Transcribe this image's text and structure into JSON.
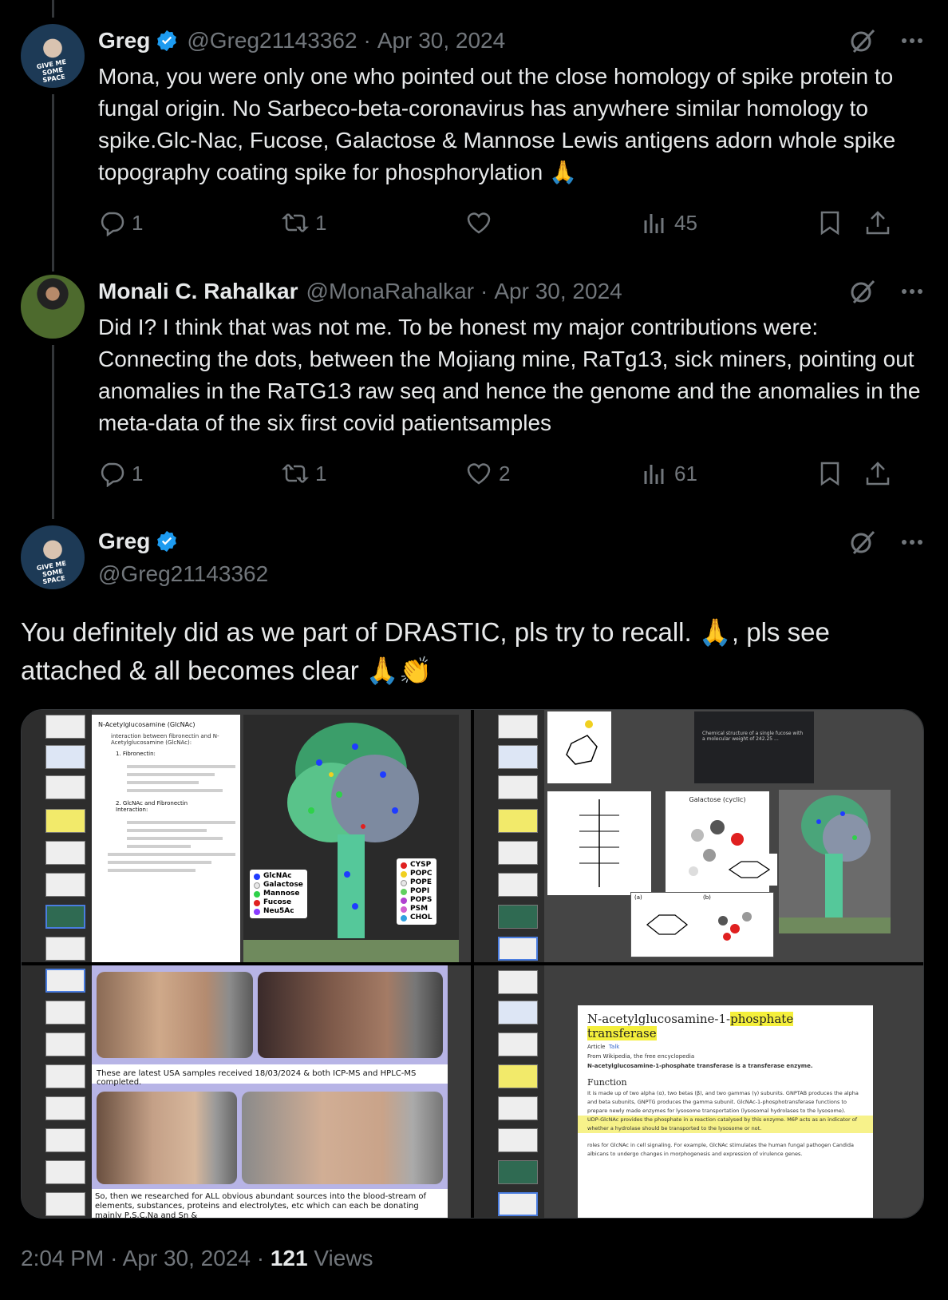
{
  "tweets": [
    {
      "name": "Greg",
      "handle": "@Greg21143362",
      "separator": "·",
      "date": "Apr 30, 2024",
      "text": "Mona, you were only one who pointed out the close homology of spike protein to fungal origin. No Sarbeco-beta-coronavirus has anywhere similar homology to spike.Glc-Nac, Fucose, Galactose & Mannose Lewis antigens adorn whole spike topography coating spike for phosphorylation 🙏",
      "replies": "1",
      "reposts": "1",
      "likes": "",
      "views": "45"
    },
    {
      "name": "Monali C. Rahalkar",
      "handle": "@MonaRahalkar",
      "separator": "·",
      "date": "Apr 30, 2024",
      "text": "Did I? I think that was not me. To be honest my major contributions were: Connecting the dots, between the Mojiang mine, RaTg13, sick miners, pointing out anomalies in the RaTG13 raw seq and hence the genome and the anomalies in the meta-data of the six first covid patientsamples",
      "replies": "1",
      "reposts": "1",
      "likes": "2",
      "views": "61"
    }
  ],
  "main_tweet": {
    "name": "Greg",
    "handle": "@Greg21143362",
    "text_line1": "You definitely did as we part of DRASTIC, pls try to recall. 🙏,  pls  see",
    "text_line2": "attached  &  all  becomes  clear  🙏👏",
    "footer_time": "2:04 PM",
    "footer_sep": "·",
    "footer_date": "Apr 30, 2024",
    "footer_views_count": "121",
    "footer_views_label": "Views"
  },
  "media": {
    "panel1": {
      "doc_title": "N-Acetylglucosamine (GlcNAc)",
      "doc_heading": "interaction between fibronectin and N-Acetylglucosamine (GlcNAc):",
      "doc_item1": "1. Fibronectin:",
      "doc_item2": "2. GlcNAc and Fibronectin Interaction:",
      "legend_left": [
        "GlcNAc",
        "Galactose",
        "Mannose",
        "Fucose",
        "Neu5Ac"
      ],
      "legend_right": [
        "CYSP",
        "POPC",
        "POPE",
        "POPI",
        "POPS",
        "PSM",
        "CHOL"
      ],
      "legend_left_colors": [
        "#1f3cff",
        "#e8e8e8",
        "#2fd14a",
        "#e02020",
        "#8a3cff"
      ],
      "legend_right_colors": [
        "#e02020",
        "#f0d020",
        "#e7e7e7",
        "#60d060",
        "#b040d0",
        "#d060d0",
        "#2fa0e0"
      ]
    },
    "panel2": {
      "galactose_label": "Galactose (cyclic)",
      "fucose_caption": "Chemical structure of a single fucose with a molecular weight of 242.25 ...",
      "label_a": "(a)",
      "label_b": "(b)"
    },
    "panel3": {
      "caption_top": "These are latest USA samples received 18/03/2024 & both ICP-MS and HPLC-MS completed.",
      "caption_bottom": "So, then we researched for ALL obvious abundant sources into the blood-stream of elements, substances, proteins and electrolytes, etc which can each be donating mainly P,S,C,Na and Sn &"
    },
    "panel4": {
      "title_prefix": "N-acetylglucosamine-1-",
      "title_highlight": "phosphate transferase",
      "tab_article": "Article",
      "tab_talk": "Talk",
      "from_wiki": "From Wikipedia, the free encyclopedia",
      "lead": "N-acetylglucosamine-1-phosphate transferase is a transferase enzyme.",
      "heading": "Function",
      "para1": "It is made up of two alpha (α), two betas (β), and two gammas (γ) subunits. GNPTAB produces the alpha and beta subunits, GNPTG produces the gamma subunit. GlcNAc-1-phosphotransferase functions to prepare newly made enzymes for lysosome transportation (lysosomal hydrolases to the lysosome).",
      "para2": "UDP-GlcNAc provides the phosphate in a reaction catalysed by this enzyme. M6P acts as an indicator of whether a hydrolase should be transported to the lysosome or not.",
      "para3": "roles for GlcNAc in cell signaling. For example, GlcNAc stimulates the human fungal pathogen Candida albicans to undergo changes in morphogenesis and expression of virulence genes."
    }
  },
  "colors": {
    "background": "#000000",
    "text": "#e7e9ea",
    "muted": "#71767b",
    "verified": "#1d9bf0",
    "thread_line": "#333639"
  }
}
